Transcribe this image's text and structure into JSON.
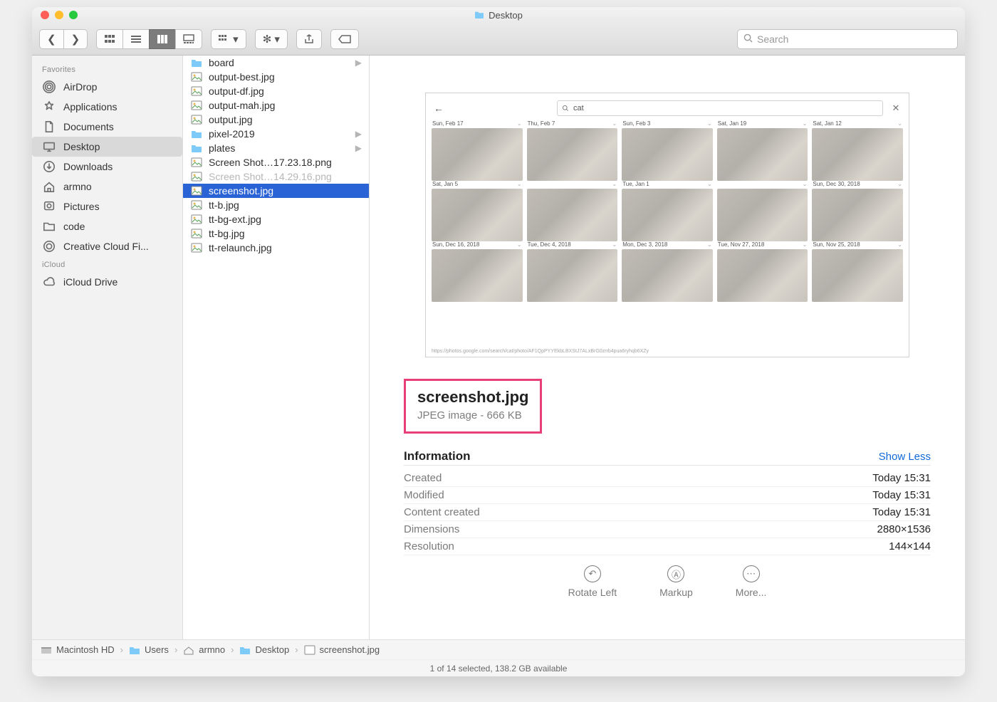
{
  "window": {
    "title": "Desktop"
  },
  "toolbar": {
    "search_placeholder": "Search"
  },
  "sidebar": {
    "sections": [
      {
        "title": "Favorites",
        "items": [
          {
            "icon": "airdrop",
            "label": "AirDrop"
          },
          {
            "icon": "apps",
            "label": "Applications"
          },
          {
            "icon": "documents",
            "label": "Documents"
          },
          {
            "icon": "desktop",
            "label": "Desktop",
            "selected": true
          },
          {
            "icon": "downloads",
            "label": "Downloads"
          },
          {
            "icon": "home",
            "label": "armno"
          },
          {
            "icon": "pictures",
            "label": "Pictures"
          },
          {
            "icon": "folder",
            "label": "code"
          },
          {
            "icon": "cc",
            "label": "Creative Cloud Fi..."
          }
        ]
      },
      {
        "title": "iCloud",
        "items": [
          {
            "icon": "cloud",
            "label": "iCloud Drive"
          }
        ]
      }
    ]
  },
  "file_column": {
    "items": [
      {
        "type": "folder",
        "name": "board",
        "folder": true
      },
      {
        "type": "image",
        "name": "output-best.jpg"
      },
      {
        "type": "image",
        "name": "output-df.jpg"
      },
      {
        "type": "image",
        "name": "output-mah.jpg"
      },
      {
        "type": "image",
        "name": "output.jpg"
      },
      {
        "type": "folder",
        "name": "pixel-2019",
        "folder": true
      },
      {
        "type": "folder",
        "name": "plates",
        "folder": true
      },
      {
        "type": "image",
        "name": "Screen Shot…17.23.18.png"
      },
      {
        "type": "image",
        "name": "Screen Shot…14.29.16.png",
        "dim": true
      },
      {
        "type": "image",
        "name": "screenshot.jpg",
        "selected": true
      },
      {
        "type": "image",
        "name": "tt-b.jpg"
      },
      {
        "type": "image",
        "name": "tt-bg-ext.jpg"
      },
      {
        "type": "image",
        "name": "tt-bg.jpg"
      },
      {
        "type": "image",
        "name": "tt-relaunch.jpg"
      }
    ]
  },
  "preview": {
    "search_term": "cat",
    "rows": [
      [
        "Sun, Feb 17",
        "Thu, Feb 7",
        "Sun, Feb 3",
        "Sat, Jan 19",
        "Sat, Jan 12"
      ],
      [
        "Sat, Jan 5",
        "",
        "Tue, Jan 1",
        "",
        "Sun, Dec 30, 2018"
      ],
      [
        "Sun, Dec 16, 2018",
        "Tue, Dec 4, 2018",
        "Mon, Dec 3, 2018",
        "Tue, Nov 27, 2018",
        "Sun, Nov 25, 2018"
      ]
    ],
    "url_hint": "https://photos.google.com/search/cat/photo/AF1QpPYYEkbLBXStJ7ALxBrG0zrrb4pua6ryhqb6XZy"
  },
  "detail": {
    "filename": "screenshot.jpg",
    "subtitle": "JPEG image - 666 KB",
    "section_title": "Information",
    "show_less": "Show Less",
    "rows": [
      {
        "k": "Created",
        "v": "Today 15:31"
      },
      {
        "k": "Modified",
        "v": "Today 15:31"
      },
      {
        "k": "Content created",
        "v": "Today 15:31"
      },
      {
        "k": "Dimensions",
        "v": "2880×1536"
      },
      {
        "k": "Resolution",
        "v": "144×144"
      }
    ],
    "actions": {
      "rotate": "Rotate Left",
      "markup": "Markup",
      "more": "More..."
    }
  },
  "path": [
    "Macintosh HD",
    "Users",
    "armno",
    "Desktop",
    "screenshot.jpg"
  ],
  "status": "1 of 14 selected, 138.2 GB available"
}
